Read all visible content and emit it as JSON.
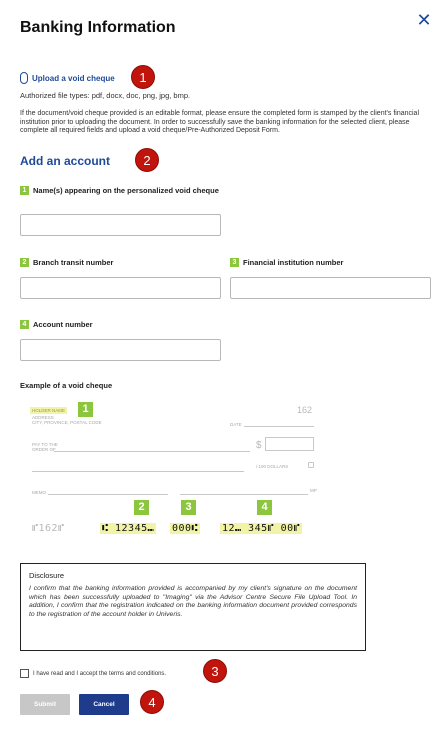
{
  "dialog": {
    "title": "Banking Information",
    "close_icon": "close-icon"
  },
  "upload": {
    "link_label": "Upload a void cheque",
    "authorized_types": "Authorized file types: pdf, docx, doc, png, jpg, bmp.",
    "note": "If the document/void cheque provided is an editable format, please ensure the completed form is stamped by the client's financial institution prior to uploading the document. In order to successfully save the banking information for the selected client, please complete all required fields and upload a void cheque/Pre-Authorized Deposit Form."
  },
  "markers": [
    "1",
    "2",
    "3",
    "4"
  ],
  "account": {
    "section_title": "Add an account",
    "fields": [
      {
        "num": "1",
        "label": "Name(s) appearing on the personalized void cheque",
        "value": ""
      },
      {
        "num": "2",
        "label": "Branch transit number",
        "value": ""
      },
      {
        "num": "3",
        "label": "Financial institution number",
        "value": ""
      },
      {
        "num": "4",
        "label": "Account number",
        "value": ""
      }
    ]
  },
  "example": {
    "label": "Example of a void cheque",
    "holder_name": "HOLDER NAME",
    "address": "ADDRESS",
    "city": "CITY, PROVINCE, POSTAL CODE",
    "cheque_number": "162",
    "date": "DATE",
    "pay_to": "PAY TO THE",
    "order_of": "ORDER OF",
    "dollars": "/ 100 DOLLARS",
    "memo": "MEMO",
    "mp": "MP",
    "badges": [
      "1",
      "2",
      "3",
      "4"
    ],
    "micr_cheque": "⑈162⑈",
    "micr_branch": "⑆ 12345⑉",
    "micr_institution": "000⑆",
    "micr_account": "12⑉ 345⑈ 00⑈"
  },
  "disclosure": {
    "title": "Disclosure",
    "text": "I confirm that the banking information provided is accompanied by my client's signature on the document which has been successfully uploaded to \"Imaging\" via the Advisor Centre Secure File Upload Tool. In addition, I confirm that the registration indicated on the banking information document provided corresponds to the registration of the account holder in Univeris."
  },
  "terms": {
    "label": "I have read and I accept the terms and conditions.",
    "checked": false
  },
  "buttons": {
    "submit": "Submit",
    "cancel": "Cancel"
  },
  "colors": {
    "accent": "#1e4a9a",
    "marker": "#c0140c",
    "badge": "#8cc63f",
    "micr_highlight": "#f1f4a6",
    "cancel_button": "#1e3b8c",
    "submit_button_disabled": "#c7c7c7"
  }
}
